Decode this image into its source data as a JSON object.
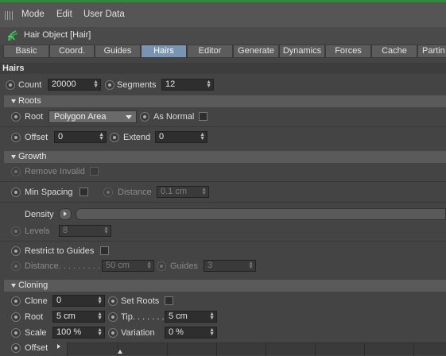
{
  "menubar": {
    "items": [
      "Mode",
      "Edit",
      "User Data"
    ]
  },
  "object": {
    "title": "Hair Object [Hair]",
    "icon": "hair-object-icon"
  },
  "tabs": [
    "Basic",
    "Coord.",
    "Guides",
    "Hairs",
    "Editor",
    "Generate",
    "Dynamics",
    "Forces",
    "Cache",
    "Partin"
  ],
  "active_tab": "Hairs",
  "section": {
    "title": "Hairs"
  },
  "top": {
    "count_label": "Count",
    "count_value": "20000",
    "segments_label": "Segments",
    "segments_value": "12"
  },
  "roots": {
    "title": "Roots",
    "root_label": "Root",
    "root_value": "Polygon Area",
    "as_normal_label": "As Normal",
    "offset_label": "Offset",
    "offset_value": "0",
    "extend_label": "Extend",
    "extend_value": "0"
  },
  "growth": {
    "title": "Growth",
    "remove_invalid_label": "Remove Invalid",
    "min_spacing_label": "Min Spacing",
    "distance_label": "Distance",
    "distance_value": "0.1 cm",
    "density_label": "Density",
    "levels_label": "Levels",
    "levels_value": "8",
    "restrict_label": "Restrict to Guides",
    "distance2_label": "Distance. . . . . . . . .",
    "distance2_value": "50 cm",
    "guides_label": "Guides",
    "guides_value": "3"
  },
  "cloning": {
    "title": "Cloning",
    "clone_label": "Clone",
    "clone_value": "0",
    "set_roots_label": "Set Roots",
    "root_label": "Root",
    "root_value": "5 cm",
    "tip_label": "Tip. . . . . . .",
    "tip_value": "5 cm",
    "scale_label": "Scale",
    "scale_value": "100 %",
    "variation_label": "Variation",
    "variation_value": "0 %",
    "offset_label": "Offset"
  },
  "colors": {
    "accent": "#2e8b3d",
    "active_tab": "#7b93b3",
    "background": "#444444"
  }
}
